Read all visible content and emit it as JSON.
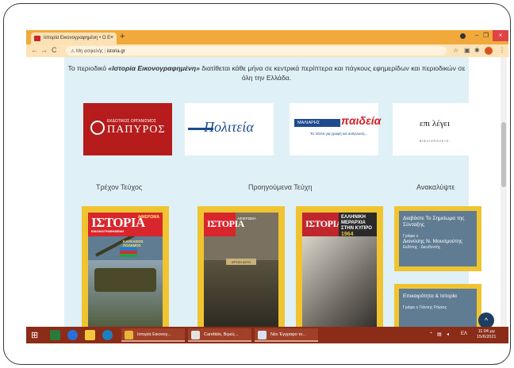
{
  "browser": {
    "tab_title": "Ιστορία Εικονογραφημένη • Ο Ε",
    "tab_close": "×",
    "new_tab": "+",
    "window_minimize": "–",
    "window_maximize": "❐",
    "window_close": "×",
    "address_security": "Μη ασφαλής",
    "address_separator": "|",
    "address_url": "istoria.gr",
    "icons": [
      "back-icon",
      "forward-icon",
      "reload-icon",
      "star-icon",
      "extension-icon",
      "puzzle-icon",
      "profile-icon",
      "menu-icon"
    ]
  },
  "page": {
    "notice_prefix": "Το περιοδικό ",
    "notice_title": "«Ιστορία Εικονογραφημένη»",
    "notice_rest": " διατίθεται κάθε μήνα σε κεντρικά περίπτερα και πάγκους εφημερίδων και περιοδικών σε όλη την Ελλάδα.",
    "sponsors": {
      "papyros_small": "ΕΚΔΟΤΙΚΟΣ ΟΡΓΑΝΙΣΜΟΣ",
      "papyros_big": "ΠΑΠΥΡΟΣ",
      "politeia": "Πολιτεία",
      "maliaris_badge": "ΜΑΛΙΑΡΗΣ",
      "maliaris_big": "παιδεία",
      "maliaris_tag": "Τα πάντα για γραφή και ανάγνωση...",
      "epilegei_logo": "επι λέγει",
      "epilegei_sub": "ΒΙΒΛΙΟΠΩΛΕΙΟ"
    },
    "headings": {
      "current": "Τρέχον Τεύχος",
      "previous": "Προηγούμενα Τεύχη",
      "discover": "Ανακαλύψτε"
    },
    "covers": {
      "masthead": "ΙΣΤΟΡΙΑ",
      "masthead_sub": "ΕΙΚΟΝΟΓΡΑΦΗΜΕΝΗ",
      "tribute": "ΑΦΙΕΡΩΜΑ",
      "cover1_headline": "ΚΑΥΚΑΣΙΟΣ ΠΟΛΕΜΟΣ",
      "cover2_caption": "ΧΡΥΣΗ ΑΥΓΗ",
      "cover3_headline": "ΕΛΛΗΝΙΚΗ ΜΕΡΑΡΧΙΑ ΣΤΗΝ ΚΥΠΡΟ",
      "cover3_year": "1964"
    },
    "side_cards": [
      {
        "title": "Διαβάστε Το Σημείωμα της Σύνταξης",
        "by": "Γράφει ο",
        "name": "Διονύσης Ν. Μουσμούτης",
        "pub": "Εκδότης - Διευθυντής"
      },
      {
        "title": "Επικαιρότητα & Ιστορία",
        "by": "Γράφει ο Γιάννης Ράγκος"
      }
    ],
    "back_to_top": "^"
  },
  "taskbar": {
    "apps": [
      {
        "label": "Ιστορία Εικονογ...",
        "icon": "chrome-icon"
      },
      {
        "label": "Caretkits, Βιρείς...",
        "icon": "acrobat-icon"
      },
      {
        "label": "Νέο Έγγραφο το...",
        "icon": "word-icon"
      }
    ],
    "language": "ΕΛ",
    "time": "11:04 μμ",
    "date": "15/6/2021"
  }
}
